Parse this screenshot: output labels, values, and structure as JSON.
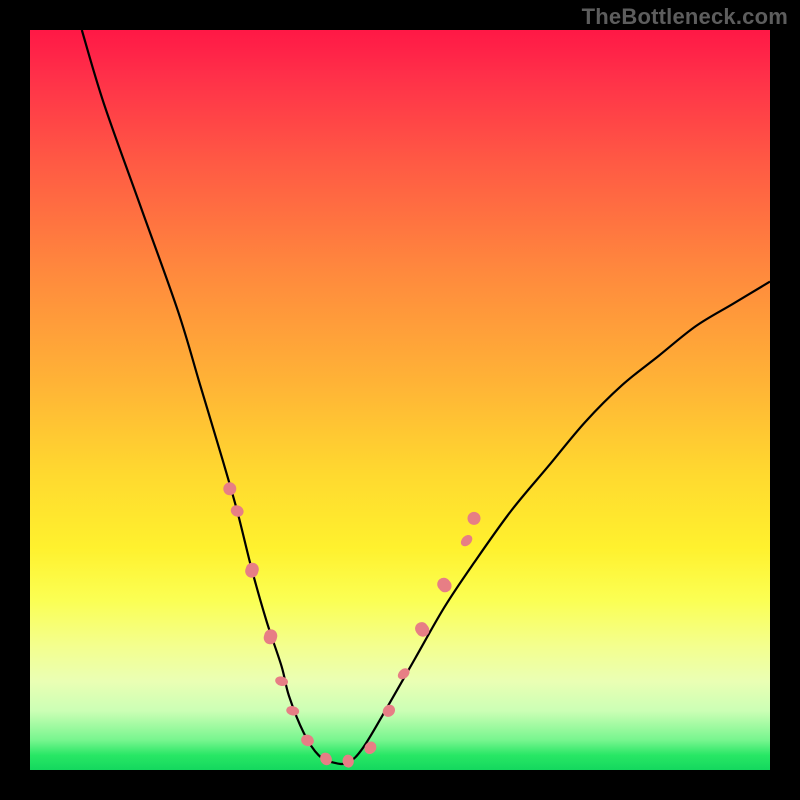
{
  "watermark": "TheBottleneck.com",
  "colors": {
    "background": "#000000",
    "curve": "#000000",
    "marker_fill": "#e77e85",
    "marker_stroke": "#d0636b",
    "gradient_stops": [
      "#ff1846",
      "#ff5a44",
      "#ff8a3d",
      "#ffb436",
      "#ffd92f",
      "#fff12e",
      "#f4ff8c",
      "#ccffb5",
      "#28e765"
    ]
  },
  "chart_data": {
    "type": "line",
    "title": "",
    "xlabel": "",
    "ylabel": "",
    "xlim": [
      0,
      100
    ],
    "ylim": [
      0,
      100
    ],
    "grid": false,
    "legend": false,
    "series": [
      {
        "name": "bottleneck-curve",
        "x": [
          7,
          10,
          15,
          20,
          23,
          26,
          28,
          30,
          32,
          34,
          35,
          37,
          39,
          41,
          43,
          45,
          48,
          52,
          56,
          60,
          65,
          70,
          75,
          80,
          85,
          90,
          95,
          100
        ],
        "y": [
          100,
          90,
          76,
          62,
          52,
          42,
          35,
          27,
          20,
          14,
          10,
          5,
          2,
          1,
          1,
          3,
          8,
          15,
          22,
          28,
          35,
          41,
          47,
          52,
          56,
          60,
          63,
          66
        ]
      }
    ],
    "markers": [
      {
        "shape": "capsule",
        "x": 28,
        "y": 35,
        "len": 6,
        "angle": 70
      },
      {
        "shape": "capsule",
        "x": 30,
        "y": 27,
        "len": 8,
        "angle": 72
      },
      {
        "shape": "capsule",
        "x": 32.5,
        "y": 18,
        "len": 8,
        "angle": 74
      },
      {
        "shape": "capsule",
        "x": 34,
        "y": 12,
        "len": 5,
        "angle": 76
      },
      {
        "shape": "capsule",
        "x": 35.5,
        "y": 8,
        "len": 5,
        "angle": 78
      },
      {
        "shape": "capsule",
        "x": 37.5,
        "y": 4,
        "len": 6,
        "angle": 65
      },
      {
        "shape": "capsule",
        "x": 40,
        "y": 1.5,
        "len": 6,
        "angle": 30
      },
      {
        "shape": "capsule",
        "x": 43,
        "y": 1.2,
        "len": 6,
        "angle": 5
      },
      {
        "shape": "capsule",
        "x": 46,
        "y": 3,
        "len": 6,
        "angle": -35
      },
      {
        "shape": "capsule",
        "x": 48.5,
        "y": 8,
        "len": 6,
        "angle": -48
      },
      {
        "shape": "capsule",
        "x": 50.5,
        "y": 13,
        "len": 5,
        "angle": -50
      },
      {
        "shape": "capsule",
        "x": 53,
        "y": 19,
        "len": 8,
        "angle": -52
      },
      {
        "shape": "capsule",
        "x": 56,
        "y": 25,
        "len": 8,
        "angle": -50
      },
      {
        "shape": "capsule",
        "x": 59,
        "y": 31,
        "len": 5,
        "angle": -46
      },
      {
        "shape": "dot",
        "x": 27,
        "y": 38
      },
      {
        "shape": "dot",
        "x": 60,
        "y": 34
      }
    ]
  }
}
